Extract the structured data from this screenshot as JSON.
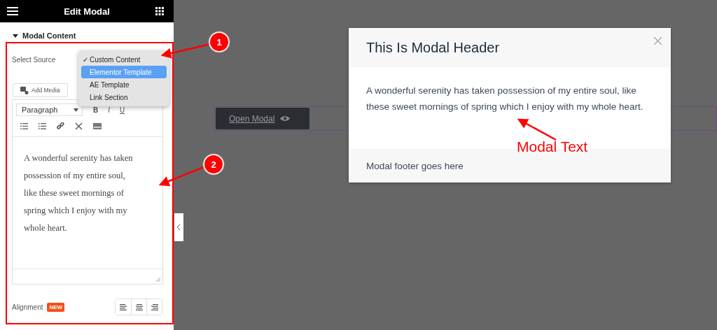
{
  "panel": {
    "title": "Edit Modal",
    "section": "Modal Content",
    "source_label": "Select Source",
    "source_options": [
      {
        "label": "Custom Content",
        "checked": true,
        "selected": false
      },
      {
        "label": "Elementor Template",
        "checked": false,
        "selected": true
      },
      {
        "label": "AE Template",
        "checked": false,
        "selected": false
      },
      {
        "label": "Link Section",
        "checked": false,
        "selected": false
      }
    ],
    "check_mark": "✓",
    "add_media": "Add Media",
    "format": "Paragraph",
    "format_buttons": [
      "B",
      "I",
      "U"
    ],
    "editor_text": "A wonderful serenity has taken possession of my entire soul, like these sweet mornings of spring which I enjoy with my whole heart.",
    "alignment_label": "Alignment",
    "alignment_badge": "NEW"
  },
  "canvas": {
    "button": "Open Modal",
    "modal": {
      "header": "This Is Modal Header",
      "body": "A wonderful serenity has taken possession of my entire soul, like these sweet mornings of spring which I enjoy with my whole heart.",
      "footer": "Modal footer goes here"
    }
  },
  "annotations": [
    {
      "number": "1"
    },
    {
      "number": "2"
    }
  ],
  "callout": "Modal Text"
}
